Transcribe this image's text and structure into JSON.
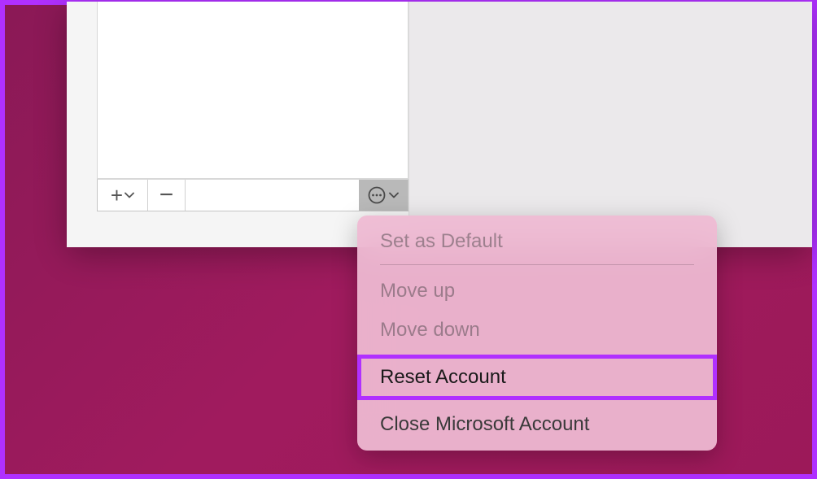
{
  "menu": {
    "set_default": "Set as Default",
    "move_up": "Move up",
    "move_down": "Move down",
    "reset_account": "Reset Account",
    "close_account": "Close Microsoft Account"
  },
  "toolbar": {
    "add": "add",
    "remove": "remove",
    "options": "options"
  }
}
